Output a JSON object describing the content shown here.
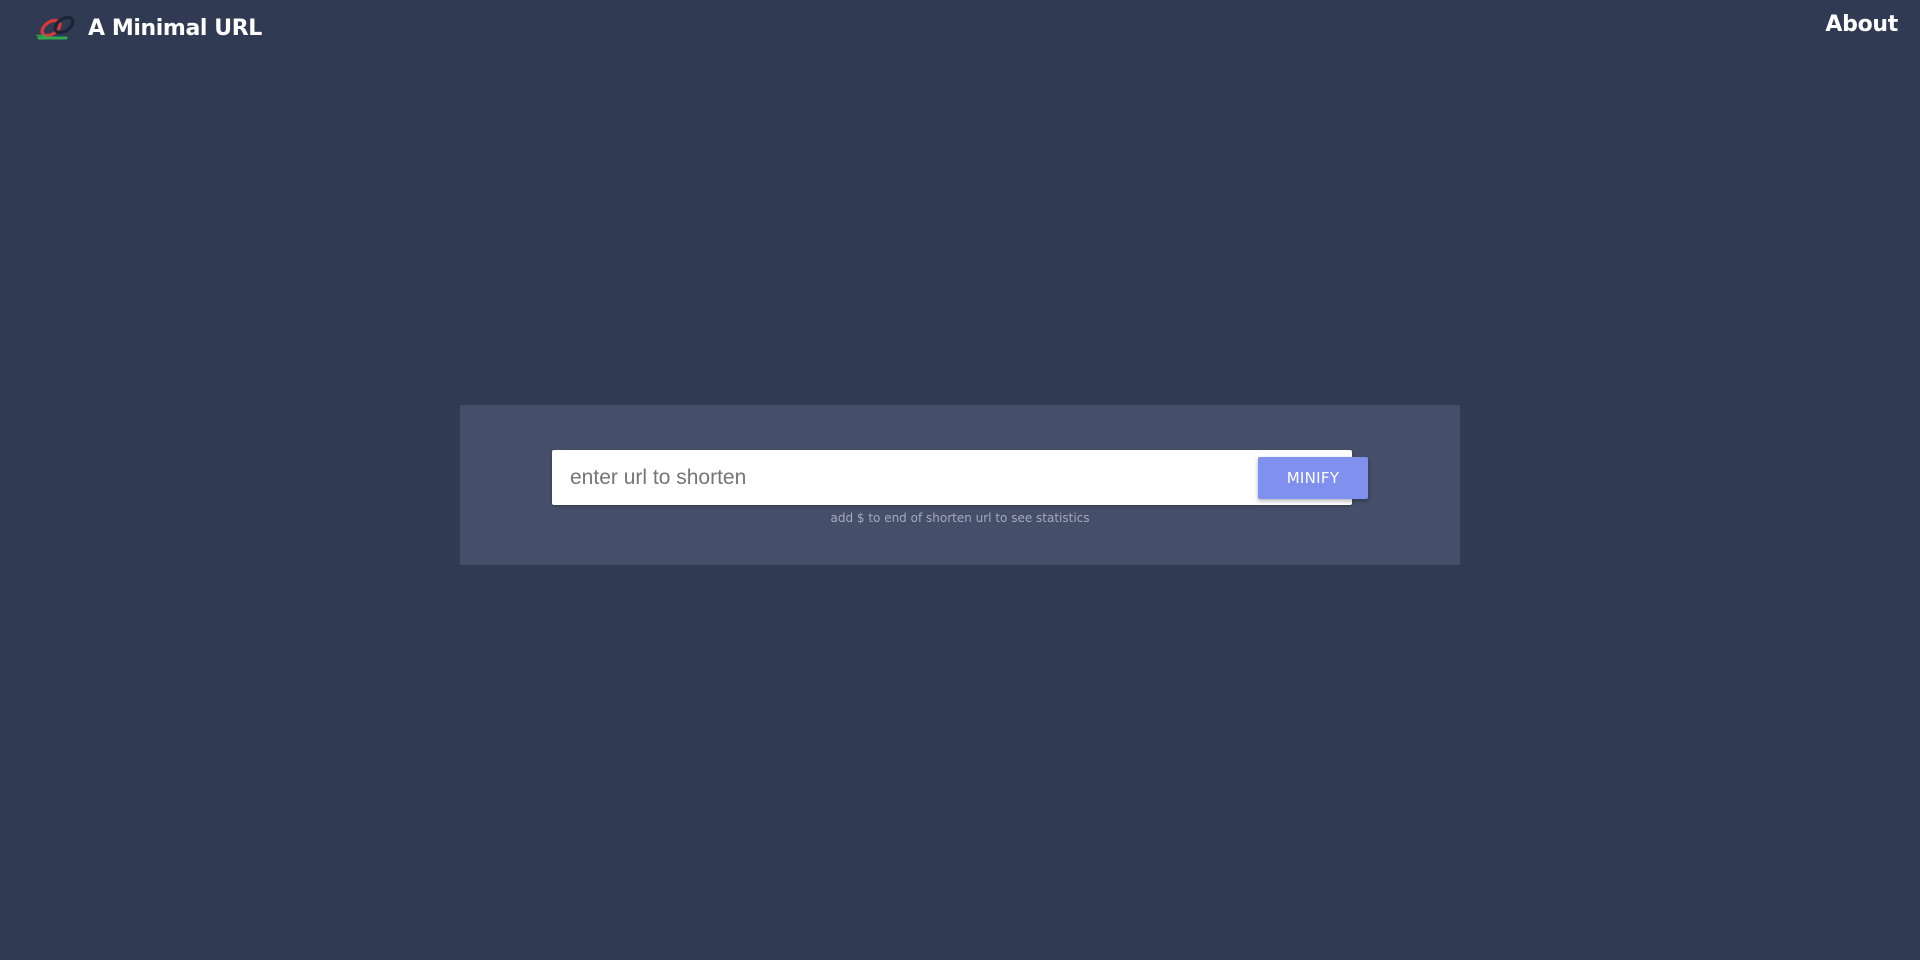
{
  "header": {
    "logo_icon": "chain-link-icon",
    "title": "A Minimal URL",
    "about_label": "About"
  },
  "form": {
    "url_placeholder": "enter url to shorten",
    "url_value": "",
    "submit_label": "MINIFY",
    "hint": "add $ to end of shorten url to see statistics"
  },
  "colors": {
    "background": "#313a53",
    "panel": "#454f69",
    "button": "#8090ef",
    "link_red": "#d83a3a",
    "link_green": "#2fa84f"
  }
}
